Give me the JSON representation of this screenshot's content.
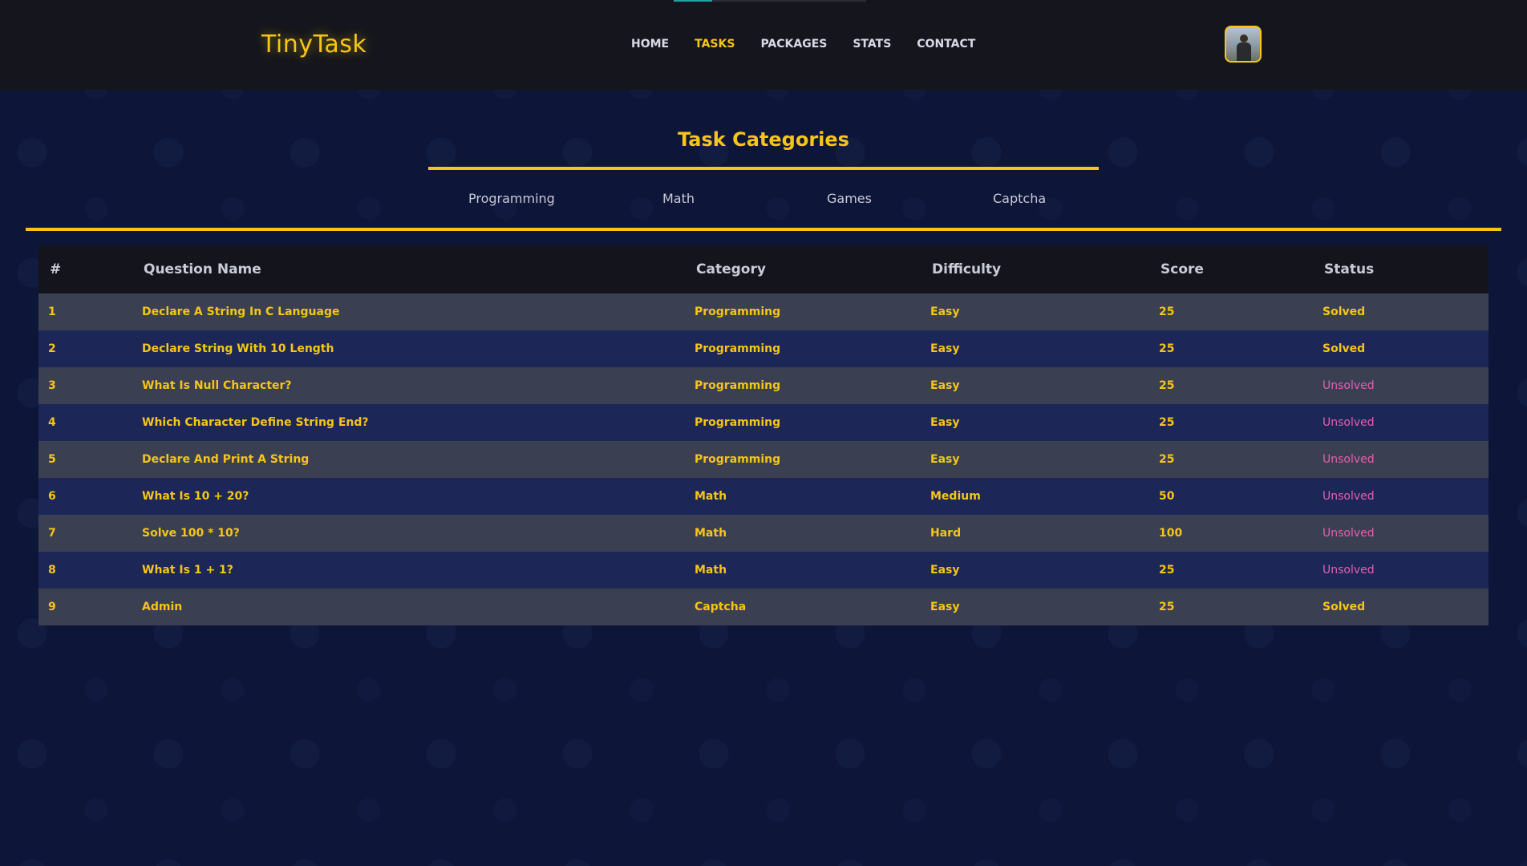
{
  "app": {
    "logo": "TinyTask"
  },
  "nav": {
    "items": [
      {
        "label": "HOME",
        "active": false
      },
      {
        "label": "TASKS",
        "active": true
      },
      {
        "label": "PACKAGES",
        "active": false
      },
      {
        "label": "STATS",
        "active": false
      },
      {
        "label": "CONTACT",
        "active": false
      }
    ]
  },
  "categories": {
    "title": "Task Categories",
    "tabs": [
      "Programming",
      "Math",
      "Games",
      "Captcha"
    ]
  },
  "table": {
    "headers": [
      "#",
      "Question Name",
      "Category",
      "Difficulty",
      "Score",
      "Status"
    ],
    "rows": [
      {
        "num": "1",
        "name": "Declare A String In C Language",
        "category": "Programming",
        "difficulty": "Easy",
        "score": "25",
        "status": "Solved"
      },
      {
        "num": "2",
        "name": "Declare String With 10 Length",
        "category": "Programming",
        "difficulty": "Easy",
        "score": "25",
        "status": "Solved"
      },
      {
        "num": "3",
        "name": "What Is Null Character?",
        "category": "Programming",
        "difficulty": "Easy",
        "score": "25",
        "status": "Unsolved"
      },
      {
        "num": "4",
        "name": "Which Character Define String End?",
        "category": "Programming",
        "difficulty": "Easy",
        "score": "25",
        "status": "Unsolved"
      },
      {
        "num": "5",
        "name": "Declare And Print A String",
        "category": "Programming",
        "difficulty": "Easy",
        "score": "25",
        "status": "Unsolved"
      },
      {
        "num": "6",
        "name": "What Is 10 + 20?",
        "category": "Math",
        "difficulty": "Medium",
        "score": "50",
        "status": "Unsolved"
      },
      {
        "num": "7",
        "name": "Solve 100 * 10?",
        "category": "Math",
        "difficulty": "Hard",
        "score": "100",
        "status": "Unsolved"
      },
      {
        "num": "8",
        "name": "What Is 1 + 1?",
        "category": "Math",
        "difficulty": "Easy",
        "score": "25",
        "status": "Unsolved"
      },
      {
        "num": "9",
        "name": "Admin",
        "category": "Captcha",
        "difficulty": "Easy",
        "score": "25",
        "status": "Solved"
      }
    ]
  },
  "colors": {
    "accent": "#f5c518",
    "unsolved": "#e45fb0",
    "header_bg": "#15161d",
    "page_bg": "#0d1538",
    "row_odd": "#3a4052",
    "row_even": "#1c2757"
  }
}
